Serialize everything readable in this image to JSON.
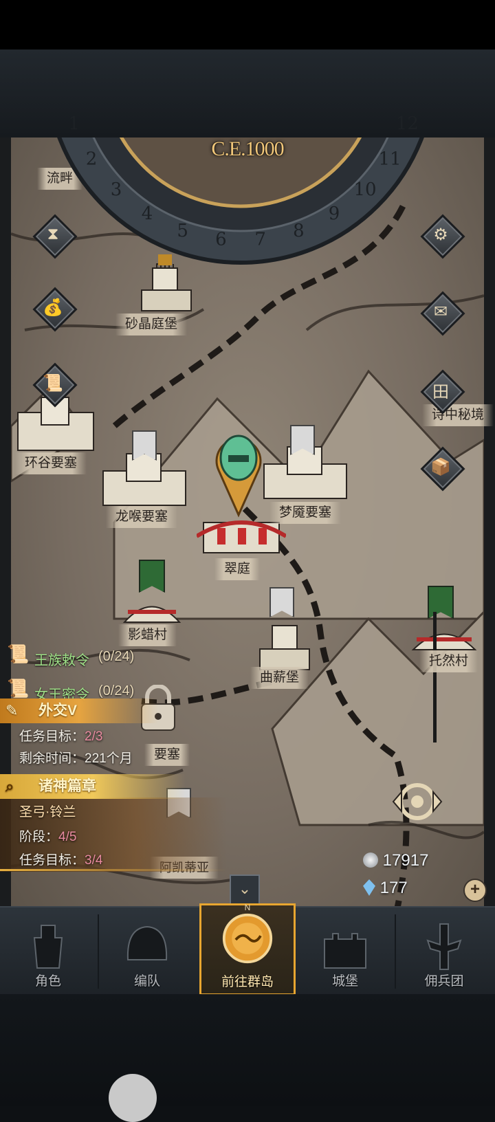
{
  "calendar": {
    "year": "C.E.1000",
    "months": [
      "1",
      "2",
      "3",
      "4",
      "5",
      "6",
      "7",
      "8",
      "9",
      "10",
      "11",
      "12"
    ]
  },
  "locations": {
    "liupan": "流畔",
    "shajing": "砂晶庭堡",
    "huangu": "环谷要塞",
    "longhou": "龙喉要塞",
    "mengmo": "梦魇要塞",
    "cuiting": "翠庭",
    "yinglacun": "影蜡村",
    "quxinbao": "曲薪堡",
    "tuoran": "托然村",
    "shizhong": "诗中秘境",
    "locked": "要塞",
    "ade": "阿凯蒂亚"
  },
  "quests": {
    "royal_decree": {
      "label": "王族敕令",
      "progress": "(0/24)"
    },
    "queen_order": {
      "label": "女王密令",
      "progress": "(0/24)"
    },
    "diplomacy": {
      "title": "外交V",
      "target_label": "任务目标：",
      "target_value": "2/3",
      "time_label": "剩余时间：",
      "time_value": "221个月"
    },
    "gods": {
      "title": "诸神篇章",
      "hero": "圣弓·铃兰",
      "stage_label": "阶段：",
      "stage_value": "4/5",
      "target_label": "任务目标：",
      "target_value": "3/4"
    }
  },
  "resources": {
    "silver": "17917",
    "crystal": "177"
  },
  "side_buttons": [
    "hourglass-icon",
    "money-bag-icon",
    "scroll-icon",
    "gear-icon",
    "mail-icon",
    "map-grid-icon",
    "supplies-icon"
  ],
  "nav": {
    "items": [
      {
        "label": "角色"
      },
      {
        "label": "编队"
      },
      {
        "label": "前往群岛"
      },
      {
        "label": "城堡"
      },
      {
        "label": "佣兵团"
      }
    ],
    "compass_n": "N"
  }
}
